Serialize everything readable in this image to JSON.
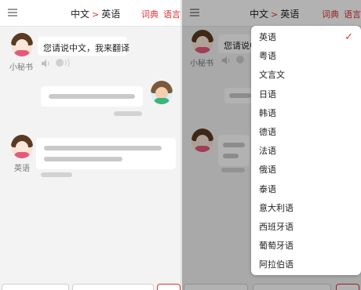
{
  "colors": {
    "accent": "#e03131",
    "background": "#f3f3f3"
  },
  "header": {
    "source_lang": "中文",
    "arrow": ">",
    "target_lang": "英语",
    "dict_label": "词典",
    "lang_label": "语言"
  },
  "left_panel": {
    "bot_name": "小秘书",
    "bot_message": "您请说中文，我来翻译",
    "reply_caption": "英语"
  },
  "right_panel": {
    "bot_name": "小秘书",
    "bot_message_visible": "您请说中"
  },
  "dropdown": {
    "selected": "英语",
    "items": [
      "英语",
      "粤语",
      "文言文",
      "日语",
      "韩语",
      "德语",
      "法语",
      "俄语",
      "泰语",
      "意大利语",
      "西班牙语",
      "葡萄牙语",
      "阿拉伯语"
    ]
  },
  "icons": {
    "menu": "hamburger-icon",
    "speaker": "speaker-icon",
    "voice": "voice-wave-icon",
    "check": "checkmark-icon"
  }
}
